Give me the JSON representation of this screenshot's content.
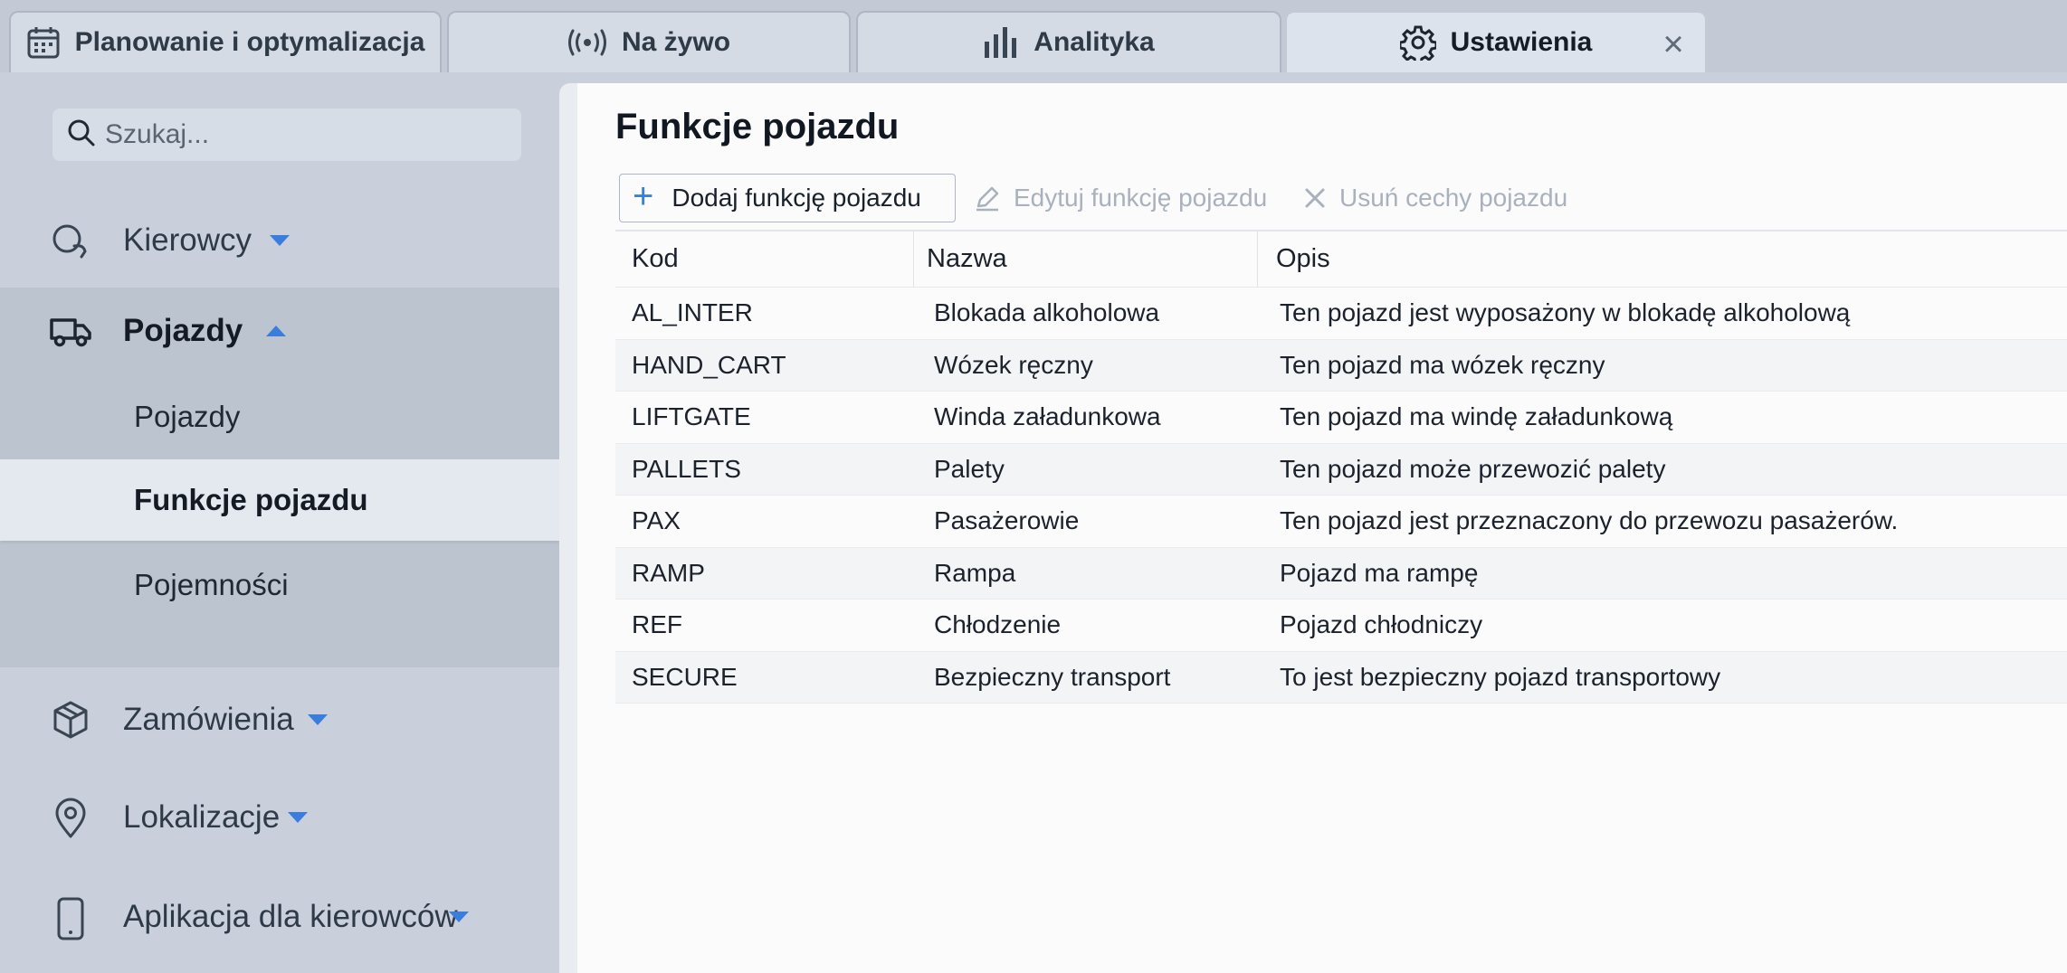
{
  "tabs": [
    {
      "label": "Planowanie i optymalizacja",
      "icon": "calendar-icon"
    },
    {
      "label": "Na żywo",
      "icon": "live-broadcast-icon"
    },
    {
      "label": "Analityka",
      "icon": "bar-chart-icon"
    },
    {
      "label": "Ustawienia",
      "icon": "gear-icon",
      "active": true
    }
  ],
  "sidebar": {
    "search_placeholder": "Szukaj...",
    "groups": [
      {
        "label": "Kierowcy",
        "icon": "drivers-icon"
      },
      {
        "label": "Pojazdy",
        "icon": "truck-icon",
        "expanded": true
      },
      {
        "label": "Zamówienia",
        "icon": "package-icon"
      },
      {
        "label": "Lokalizacje",
        "icon": "map-pin-icon"
      },
      {
        "label": "Aplikacja dla kierowców",
        "icon": "mobile-phone-icon"
      }
    ],
    "sub_items": [
      {
        "label": "Pojazdy"
      },
      {
        "label": "Funkcje pojazdu",
        "selected": true
      },
      {
        "label": "Pojemności"
      }
    ]
  },
  "main": {
    "title": "Funkcje pojazdu",
    "toolbar": {
      "add_label": "Dodaj funkcję pojazdu",
      "edit_label": "Edytuj funkcję pojazdu",
      "delete_label": "Usuń cechy pojazdu"
    },
    "table": {
      "columns": [
        "Kod",
        "Nazwa",
        "Opis"
      ],
      "rows": [
        [
          "AL_INTER",
          "Blokada alkoholowa",
          "Ten pojazd jest wyposażony w blokadę alkoholową"
        ],
        [
          "HAND_CART",
          "Wózek ręczny",
          "Ten pojazd ma wózek ręczny"
        ],
        [
          "LIFTGATE",
          "Winda załadunkowa",
          "Ten pojazd ma windę załadunkową"
        ],
        [
          "PALLETS",
          "Palety",
          "Ten pojazd może przewozić palety"
        ],
        [
          "PAX",
          "Pasażerowie",
          "Ten pojazd jest przeznaczony do przewozu pasażerów."
        ],
        [
          "RAMP",
          "Rampa",
          "Pojazd ma rampę"
        ],
        [
          "REF",
          "Chłodzenie",
          "Pojazd chłodniczy"
        ],
        [
          "SECURE",
          "Bezpieczny transport",
          "To jest bezpieczny pojazd transportowy"
        ]
      ]
    }
  },
  "colors": {
    "accent": "#3b7ddd",
    "sidebar_bg": "#c9d0db",
    "main_bg": "#fbfbfc",
    "selected_bg": "#e4e8ef"
  }
}
